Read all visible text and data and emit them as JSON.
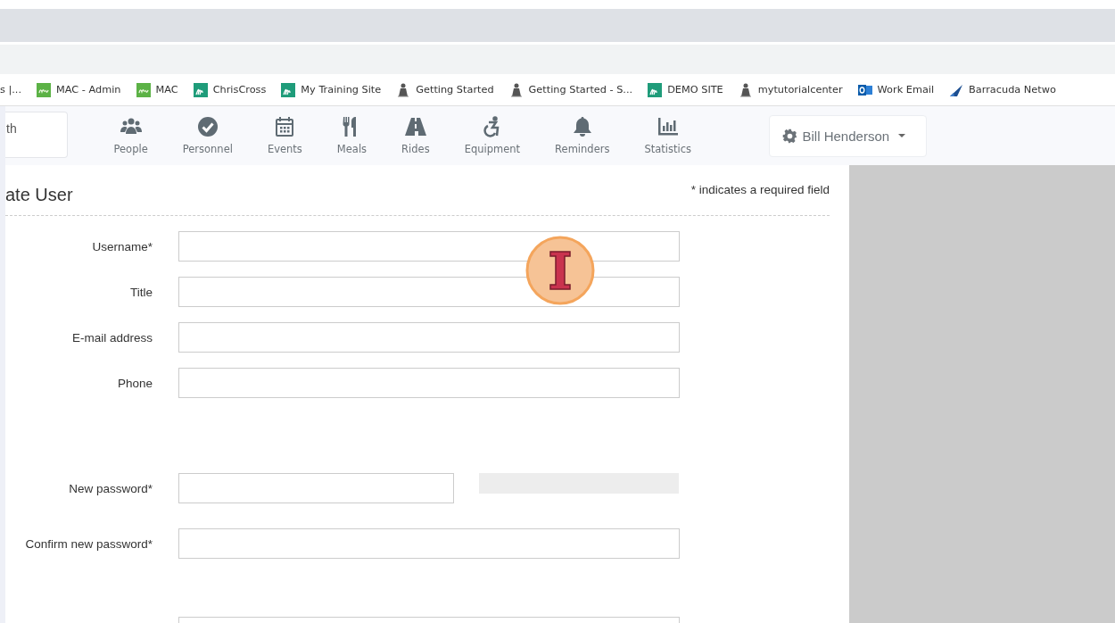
{
  "bookmarks": [
    {
      "label": "s |..."
    },
    {
      "label": "MAC - Admin"
    },
    {
      "label": "MAC"
    },
    {
      "label": "ChrisCross"
    },
    {
      "label": "My Training Site"
    },
    {
      "label": "Getting Started"
    },
    {
      "label": "Getting Started - S..."
    },
    {
      "label": "DEMO SITE"
    },
    {
      "label": "mytutorialcenter"
    },
    {
      "label": "Work Email"
    },
    {
      "label": "Barracuda Netwo"
    }
  ],
  "search": {
    "value": "th"
  },
  "nav": [
    {
      "label": "People"
    },
    {
      "label": "Personnel"
    },
    {
      "label": "Events"
    },
    {
      "label": "Meals"
    },
    {
      "label": "Rides"
    },
    {
      "label": "Equipment"
    },
    {
      "label": "Reminders"
    },
    {
      "label": "Statistics"
    }
  ],
  "user_menu": {
    "label": "Bill Henderson"
  },
  "form": {
    "title": "ate User",
    "required_note": "* indicates a required field",
    "fields": [
      {
        "label": "Username*",
        "kind": "wide"
      },
      {
        "label": "Title",
        "kind": "wide"
      },
      {
        "label": "E-mail address",
        "kind": "wide"
      },
      {
        "label": "Phone",
        "kind": "wide"
      },
      {
        "label": "New password*",
        "kind": "password"
      },
      {
        "label": "Confirm new password*",
        "kind": "wide"
      }
    ]
  }
}
